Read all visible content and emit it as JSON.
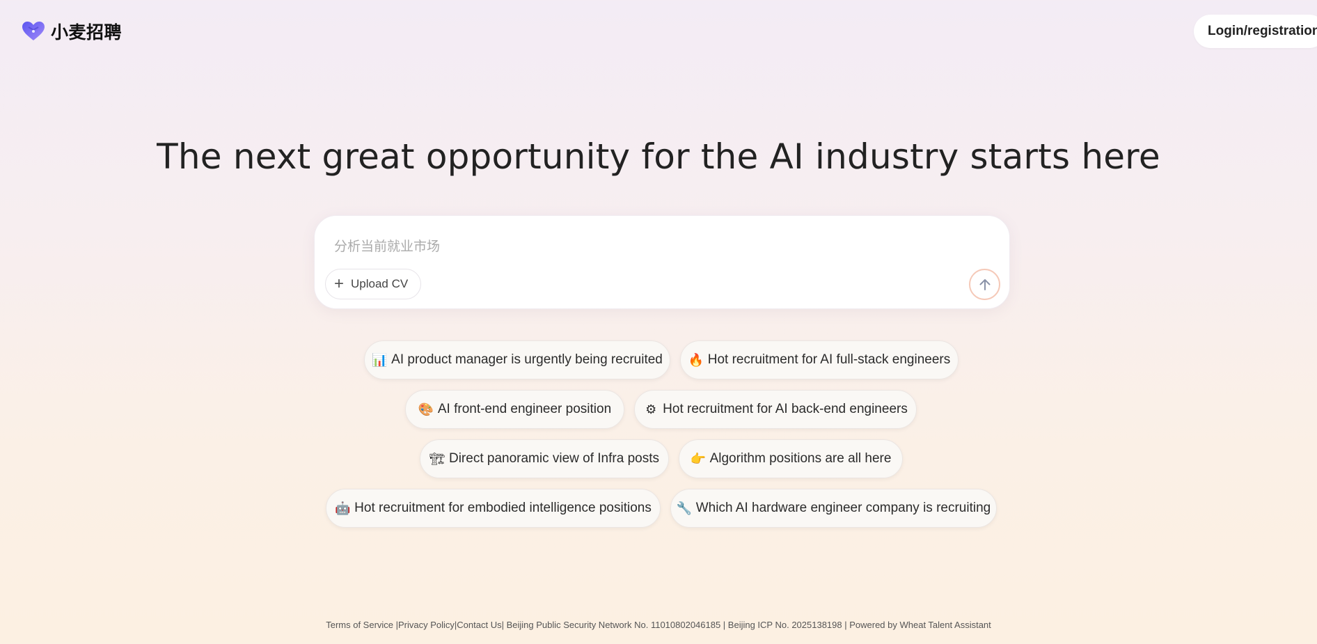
{
  "header": {
    "logo_text": "小麦招聘",
    "login_label": "Login/registration"
  },
  "hero": {
    "headline": "The next great opportunity for the AI industry starts here"
  },
  "chat": {
    "placeholder": "分析当前就业市场",
    "upload_label": "Upload CV"
  },
  "chips": [
    {
      "icon": "📊",
      "label": "AI product manager is urgently being recruited"
    },
    {
      "icon": "🔥",
      "label": "Hot recruitment for AI full-stack engineers"
    },
    {
      "icon": "🎨",
      "label": "AI front-end engineer position"
    },
    {
      "icon": "⚙",
      "label": "Hot recruitment for AI back-end engineers"
    },
    {
      "icon": "🏗",
      "label": "Direct panoramic view of Infra posts"
    },
    {
      "icon": "👉",
      "label": "Algorithm positions are all here"
    },
    {
      "icon": "🤖",
      "label": "Hot recruitment for embodied intelligence positions"
    },
    {
      "icon": "🔧",
      "label": "Which AI hardware engineer company is recruiting"
    }
  ],
  "footer": {
    "text": "Terms of Service |Privacy Policy|Contact Us| Beijing Public Security Network No. 11010802046185 | Beijing ICP No. 2025138198 | Powered by Wheat Talent Assistant"
  },
  "colors": {
    "logo_start": "#6a5cf5",
    "logo_end": "#9a7cf7",
    "send_ring": "#f5c9b8",
    "send_arrow": "#8a93a8"
  }
}
